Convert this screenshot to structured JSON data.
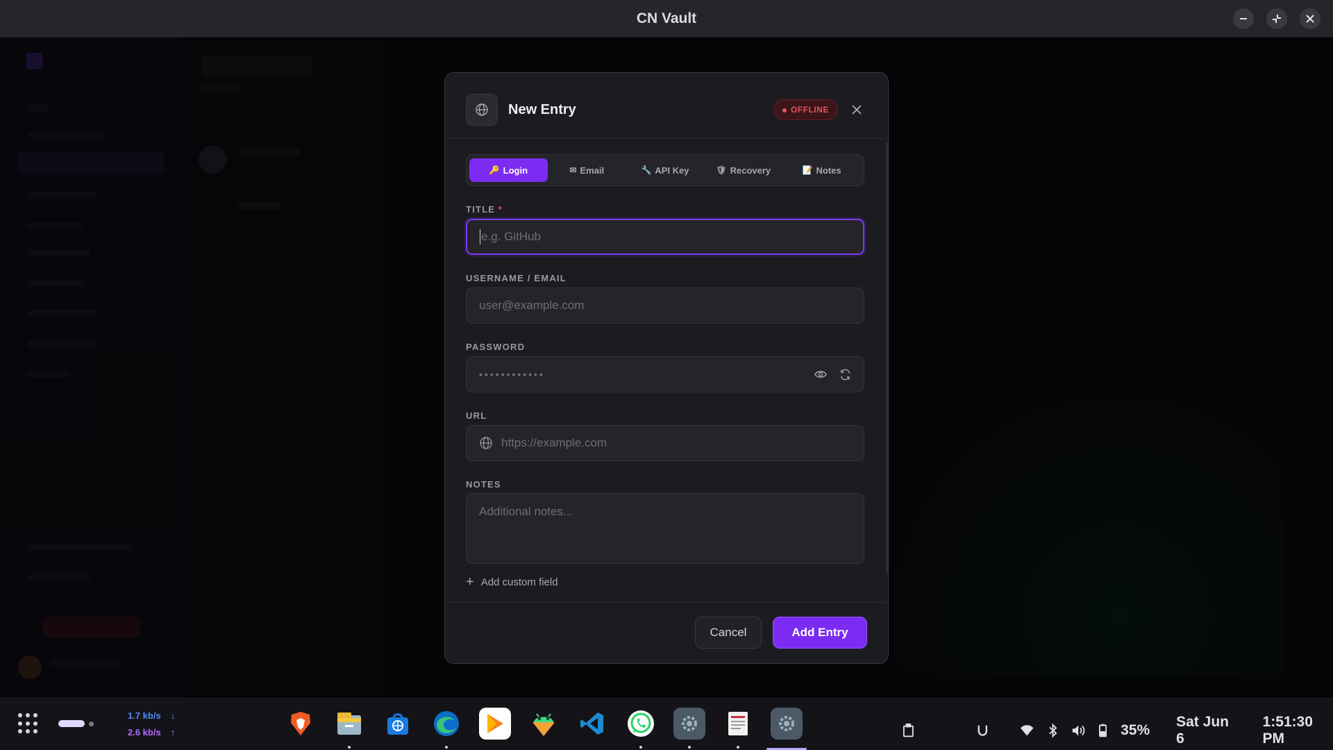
{
  "window": {
    "title": "CN Vault",
    "controls": [
      "minimize",
      "restore",
      "close"
    ]
  },
  "modal": {
    "title": "New Entry",
    "status_badge": "OFFLINE",
    "tabs": [
      {
        "glyph": "🔑",
        "label": "Login",
        "active": true
      },
      {
        "glyph": "✉",
        "label": "Email",
        "active": false
      },
      {
        "glyph": "🔧",
        "label": "API Key",
        "active": false
      },
      {
        "glyph": "🛡",
        "label": "Recovery",
        "active": false
      },
      {
        "glyph": "📝",
        "label": "Notes",
        "active": false
      }
    ],
    "fields": {
      "title": {
        "label": "TITLE",
        "required_mark": "*",
        "placeholder": "e.g. GitHub",
        "value": ""
      },
      "username": {
        "label": "USERNAME / EMAIL",
        "placeholder": "user@example.com",
        "value": ""
      },
      "password": {
        "label": "PASSWORD",
        "masked_value": "••••••••••••"
      },
      "url": {
        "label": "URL",
        "placeholder": "https://example.com",
        "value": ""
      },
      "notes": {
        "label": "NOTES",
        "placeholder": "Additional notes..."
      }
    },
    "add_custom_field": "Add custom field",
    "buttons": {
      "cancel": "Cancel",
      "submit": "Add Entry"
    }
  },
  "taskbar": {
    "net_down": "1.7 kb/s",
    "net_up": "2.6 kb/s",
    "net_down_arrow": "↓",
    "net_up_arrow": "↑",
    "apps": [
      "brave",
      "files",
      "software-store",
      "edge",
      "play-store",
      "android-studio",
      "vscode",
      "whatsapp",
      "settings",
      "text-editor",
      "settings-active"
    ],
    "battery": "35%",
    "date": "Sat Jun 6",
    "time": "1:51:30 PM"
  },
  "colors": {
    "accent": "#7c2cf2",
    "offline": "#e2545e",
    "panel": "#1c1b20"
  }
}
